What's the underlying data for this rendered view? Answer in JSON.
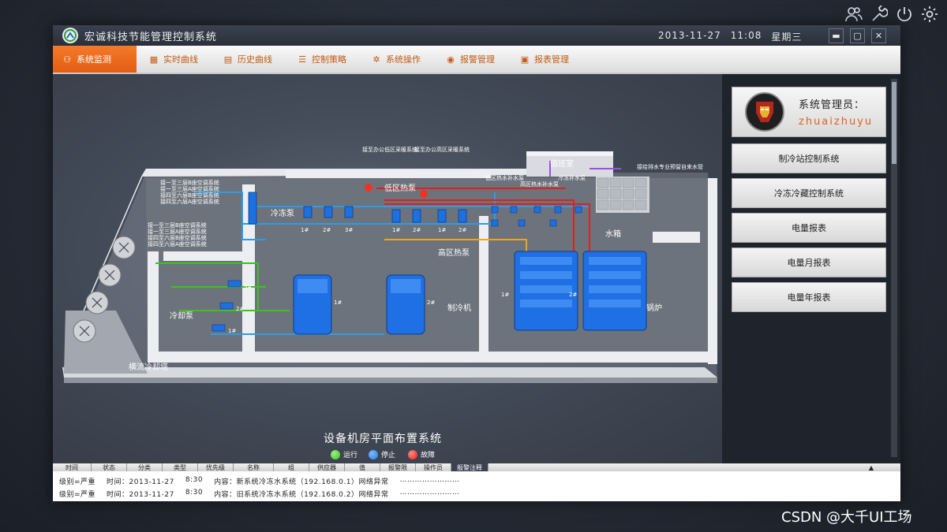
{
  "window": {
    "title": "宏诚科技节能管理控制系统",
    "date": "2013-11-27",
    "time": "11:08",
    "weekday": "星期三"
  },
  "desktop_icons": [
    "users-icon",
    "wrench-icon",
    "power-icon",
    "gear-icon"
  ],
  "nav": {
    "tabs": [
      {
        "label": "系统监测",
        "icon": "monitor-icon",
        "active": true
      },
      {
        "label": "实时曲线",
        "icon": "chart-icon"
      },
      {
        "label": "历史曲线",
        "icon": "history-icon"
      },
      {
        "label": "控制策略",
        "icon": "list-icon"
      },
      {
        "label": "系统操作",
        "icon": "gear-icon"
      },
      {
        "label": "报警管理",
        "icon": "alarm-icon"
      },
      {
        "label": "报表管理",
        "icon": "report-icon"
      }
    ]
  },
  "sidebar": {
    "user_label": "系统管理员：",
    "user_name": "zhuaizhuyu",
    "buttons": [
      "制冷站控制系统",
      "冷冻冷藏控制系统",
      "电量报表",
      "电量月报表",
      "电量年报表"
    ]
  },
  "plan": {
    "caption": "设备机房平面布置系统",
    "legend": [
      {
        "label": "运行",
        "color": "#3cc21f"
      },
      {
        "label": "停止",
        "color": "#1e7fe6"
      },
      {
        "label": "故障",
        "color": "#e0201c"
      }
    ],
    "labels": {
      "chilled_pump": "冷冻泵",
      "low_zone": "低区热泵",
      "high_zone": "高区热泵",
      "duty_room": "值班室",
      "water_tank": "水箱",
      "chiller": "制冷机",
      "boiler": "锅炉",
      "cooling_pump": "冷却泵",
      "cooling_tower": "横流冷却塔",
      "low_refill": "低区热水补水泵",
      "high_refill": "高区热水补水泵",
      "cold_refill": "冷冻补水泵",
      "office_low": "接至办公低区采暖系统",
      "office_high": "接至办公高区采暖系统",
      "drain": "接给排水专业预留自来水管",
      "ac_left_1": "接一至三层B座空调系统",
      "ac_left_2": "接一至三层A座空调系统",
      "ac_left_3": "接四至六层B座空调系统",
      "ac_left_4": "接四至六层A座空调系统",
      "ac_left_5": "接一至三层B座空调系统",
      "ac_left_6": "接一至三层A座空调系统",
      "ac_left_7": "接四至六层B座空调系统",
      "ac_left_8": "接四至六层A座空调系统",
      "n1": "1#",
      "n2": "2#",
      "n3": "3#"
    }
  },
  "log": {
    "columns": [
      "时间",
      "状态",
      "分类",
      "类型",
      "优先级",
      "名称",
      "组",
      "供应器",
      "值",
      "报警限",
      "操作员",
      "报警注释"
    ],
    "rows": [
      {
        "level": "级别=严重",
        "time": "时间：2013-11-27",
        "clock": "8:30",
        "content": "内容：新系统冷冻水系统（192.168.0.1）网络异常",
        "dots": "……………………"
      },
      {
        "level": "级别=严重",
        "time": "时间：2013-11-27",
        "clock": "8:30",
        "content": "内容：旧系统冷冻水系统（192.168.0.2）网络异常",
        "dots": "……………………"
      }
    ]
  },
  "watermark": "CSDN @大千UI工场"
}
